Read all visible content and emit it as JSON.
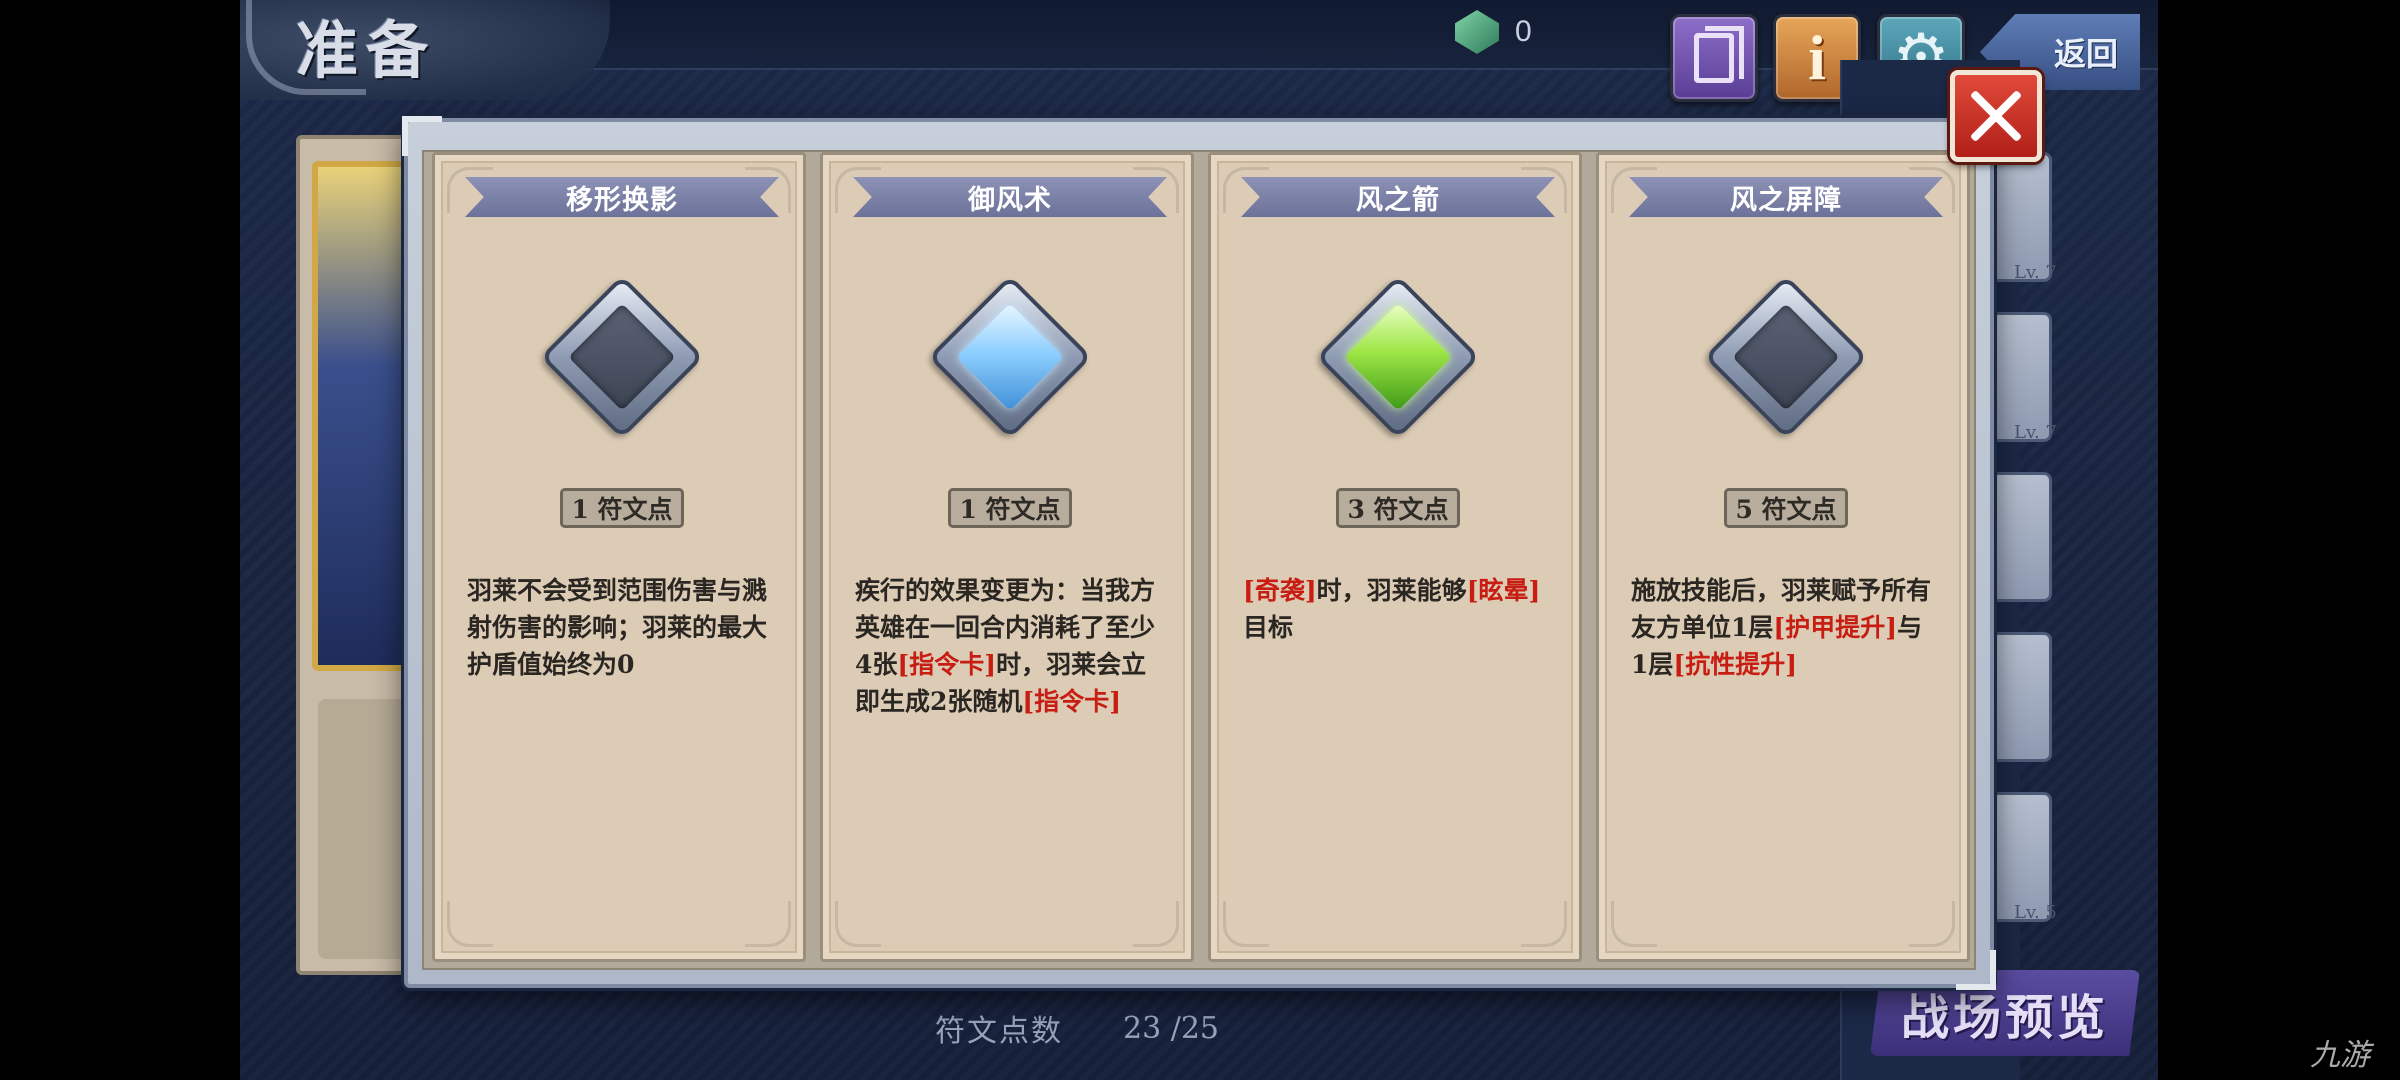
{
  "header": {
    "title": "准备",
    "gem_count": "0",
    "back_label": "返回"
  },
  "toolbar": {
    "book_icon": "book-icon",
    "info_icon": "info-icon",
    "info_glyph": "i",
    "gear_icon": "gear-icon",
    "gear_glyph": "⚙"
  },
  "units": [
    {
      "lv": "Lv. 7"
    },
    {
      "lv": "Lv. 7"
    },
    {
      "lv": ""
    },
    {
      "lv": ""
    },
    {
      "lv": "Lv. 5"
    }
  ],
  "footer": {
    "rune_points_label": "符文点数",
    "rune_points_value": "23 /25",
    "battle_preview_label": "战场预览"
  },
  "modal": {
    "cards": [
      {
        "title": "移形换影",
        "gem_state": "empty",
        "cost": "1 符文点",
        "desc": [
          {
            "t": "羽莱不会受到范围伤害与溅射伤害的影响；羽莱的最大护盾值始终为0",
            "kw": false
          }
        ]
      },
      {
        "title": "御风术",
        "gem_state": "blue",
        "cost": "1 符文点",
        "desc": [
          {
            "t": "疾行的效果变更为：当我方英雄在一回合内消耗了至少4张",
            "kw": false
          },
          {
            "t": "[指令卡]",
            "kw": true
          },
          {
            "t": "时，羽莱会立即生成2张随机",
            "kw": false
          },
          {
            "t": "[指令卡]",
            "kw": true
          }
        ]
      },
      {
        "title": "风之箭",
        "gem_state": "green",
        "cost": "3 符文点",
        "desc": [
          {
            "t": "[奇袭]",
            "kw": true
          },
          {
            "t": "时，羽莱能够",
            "kw": false
          },
          {
            "t": "[眩晕]",
            "kw": true
          },
          {
            "t": "目标",
            "kw": false
          }
        ]
      },
      {
        "title": "风之屏障",
        "gem_state": "empty",
        "cost": "5 符文点",
        "desc": [
          {
            "t": "施放技能后，羽莱赋予所有友方单位1层",
            "kw": false
          },
          {
            "t": "[护甲提升]",
            "kw": true
          },
          {
            "t": "与1层",
            "kw": false
          },
          {
            "t": "[抗性提升]",
            "kw": true
          }
        ]
      }
    ]
  },
  "watermark": "九游",
  "colors": {
    "keyword": "#c81d12",
    "card_bg": "#dccbb5",
    "ribbon": "#7a7fa8",
    "close": "#d43a2c"
  }
}
